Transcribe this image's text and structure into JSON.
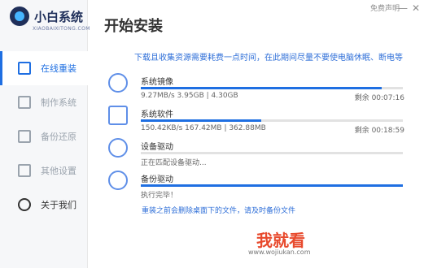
{
  "app": {
    "title": "小白系统",
    "subtitle": "XIAOBAIXITONG.COM"
  },
  "header": {
    "title": "开始安装",
    "top_link": "免费声明",
    "minimize": "—",
    "close": "✕"
  },
  "sidebar": {
    "items": [
      {
        "label": "在线重装",
        "icon": "monitor-icon"
      },
      {
        "label": "制作系统",
        "icon": "usb-icon"
      },
      {
        "label": "备份还原",
        "icon": "backup-icon"
      },
      {
        "label": "其他设置",
        "icon": "settings-icon"
      },
      {
        "label": "关于我们",
        "icon": "info-icon"
      }
    ]
  },
  "main": {
    "notice": "下载且收集资源需要耗费一点时间，在此期间尽量不要使电脑休眠、断电等",
    "tasks": [
      {
        "name": "系统镜像",
        "speed": "9.27MB/s 3.95GB | 4.30GB",
        "remaining": "剩余 00:07:16",
        "progress": 0.92
      },
      {
        "name": "系统软件",
        "speed": "150.42KB/s 167.42MB | 362.88MB",
        "remaining": "剩余 00:18:59",
        "progress": 0.46
      },
      {
        "name": "设备驱动",
        "speed": "正在匹配设备驱动...",
        "remaining": "",
        "progress": 0
      },
      {
        "name": "备份驱动",
        "speed": "执行完毕！",
        "remaining": "",
        "progress": 1.0
      }
    ],
    "bottom_tip": "重装之前会删除桌面下的文件，请及时备份文件",
    "watermark": "我就看",
    "watermark_url": "www.wojiukan.com"
  }
}
